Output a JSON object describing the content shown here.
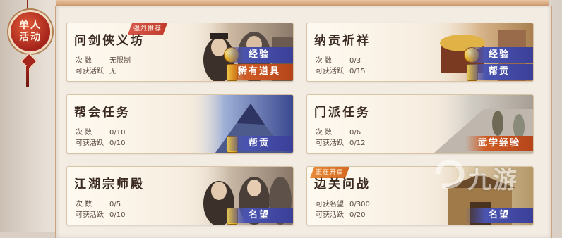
{
  "side_badge": {
    "line1": "单人",
    "line2": "活动"
  },
  "labels": {
    "times": "次    数",
    "active": "可获活跃",
    "reputation": "可获名望"
  },
  "cards": [
    {
      "title": "问剑侠义坊",
      "tag": "强烈推荐",
      "times": "无限制",
      "active": "无",
      "rewards": [
        "经验",
        "稀有道具"
      ]
    },
    {
      "title": "纳贡祈祥",
      "times": "0/3",
      "active": "0/15",
      "rewards": [
        "经验",
        "帮贡"
      ]
    },
    {
      "title": "帮会任务",
      "times": "0/10",
      "active": "0/10",
      "rewards": [
        "帮贡"
      ]
    },
    {
      "title": "门派任务",
      "times": "0/6",
      "active": "0/12",
      "rewards": [
        "武学经验"
      ]
    },
    {
      "title": "江湖宗师殿",
      "times": "0/5",
      "active": "0/10",
      "rewards": [
        "名望"
      ]
    },
    {
      "title": "边关问战",
      "tag": "正在开启",
      "reputation": "0/300",
      "active": "0/20",
      "rewards": [
        "名望"
      ]
    }
  ],
  "watermark": "九游",
  "colors": {
    "blue_ribbon": "#4a54b0",
    "orange_ribbon": "#cf5b24",
    "tag_red": "#c23b2c",
    "tag_orange": "#d56a22"
  }
}
